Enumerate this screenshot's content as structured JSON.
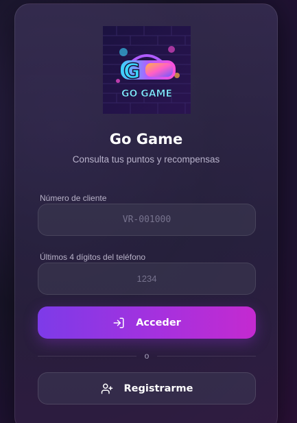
{
  "logo": {
    "text": "GO GAME",
    "letters": "GO"
  },
  "app": {
    "title": "Go Game",
    "subtitle": "Consulta tus puntos y recompensas"
  },
  "form": {
    "client_number": {
      "label": "Número de cliente",
      "placeholder": "VR-001000",
      "value": ""
    },
    "phone_digits": {
      "label": "Últimos 4 dígitos del teléfono",
      "placeholder": "1234",
      "value": ""
    }
  },
  "actions": {
    "login": {
      "label": "Acceder",
      "icon": "login-icon"
    },
    "divider_text": "o",
    "register": {
      "label": "Registrarme",
      "icon": "user-plus-icon"
    }
  },
  "colors": {
    "accent_start": "#7d3be8",
    "accent_end": "#c42ad0"
  }
}
